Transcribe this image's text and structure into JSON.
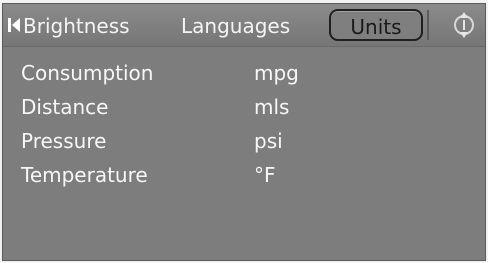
{
  "tabs": {
    "brightness": "Brightness",
    "languages": "Languages",
    "units": "Units"
  },
  "units_settings": [
    {
      "label": "Consumption",
      "value": "mpg"
    },
    {
      "label": "Distance",
      "value": "mls"
    },
    {
      "label": "Pressure",
      "value": "psi"
    },
    {
      "label": "Temperature",
      "value": "°F"
    }
  ],
  "icons": {
    "scroll_left": "triangle-left-icon",
    "scroll_control": "up-down-scroll-icon"
  },
  "colors": {
    "screen_background": "#7d7d7d",
    "text": "#ffffff",
    "active_tab_text": "#1a1a1a"
  }
}
